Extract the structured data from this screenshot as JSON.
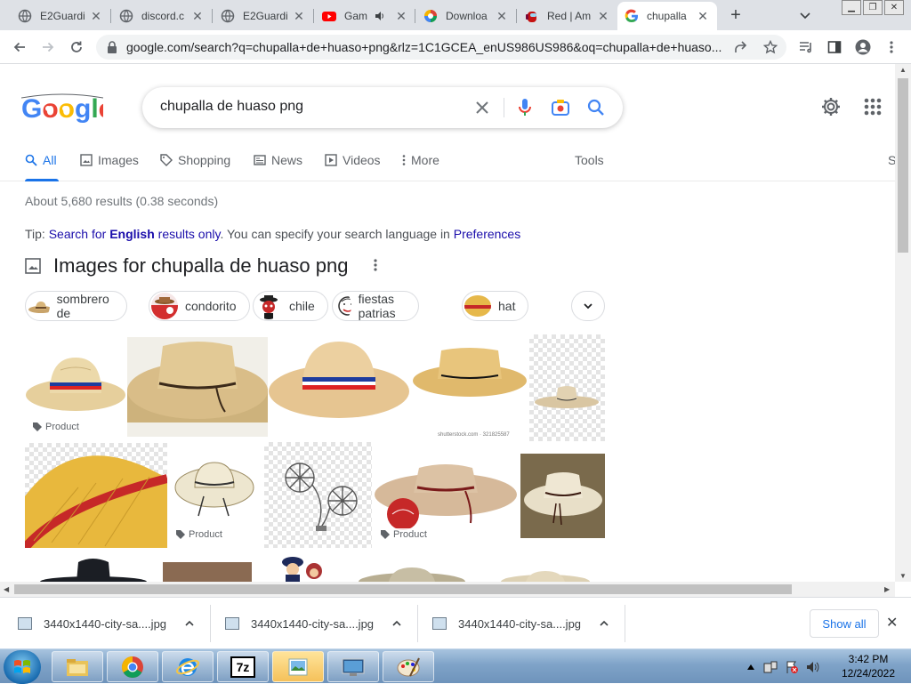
{
  "browser": {
    "tabs": [
      {
        "title": "E2Guardi",
        "icon": "globe-icon"
      },
      {
        "title": "discord.c",
        "icon": "globe-icon"
      },
      {
        "title": "E2Guardi",
        "icon": "globe-icon"
      },
      {
        "title": "Gam",
        "icon": "youtube-icon",
        "audio": true
      },
      {
        "title": "Downloa",
        "icon": "color-wheel-icon"
      },
      {
        "title": "Red | Am",
        "icon": "among-us-icon"
      },
      {
        "title": "chupalla",
        "icon": "google-icon",
        "active": true
      }
    ],
    "url": "google.com/search?q=chupalla+de+huaso+png&rlz=1C1GCEA_enUS986US986&oq=chupalla+de+huaso..."
  },
  "search": {
    "query": "chupalla de huaso png",
    "logo_text": "Google"
  },
  "nav": {
    "all": "All",
    "images": "Images",
    "shopping": "Shopping",
    "news": "News",
    "videos": "Videos",
    "more": "More",
    "tools": "Tools",
    "cut": "S"
  },
  "results": {
    "stats": "About 5,680 results (0.38 seconds)",
    "tip": {
      "prefix": "Tip: ",
      "search_for": "Search for ",
      "english": "English",
      "results_only": " results only",
      "middle": ". You can specify your search language in ",
      "preferences": "Preferences"
    }
  },
  "images_section": {
    "title": "Images for chupalla de huaso png",
    "chips": [
      "sombrero de",
      "condorito",
      "chile",
      "fiestas patrias",
      "hat"
    ],
    "product_label": "Product",
    "watermark": "shutterstock.com · 321825587"
  },
  "downloads": {
    "items": [
      "3440x1440-city-sa....jpg",
      "3440x1440-city-sa....jpg",
      "3440x1440-city-sa....jpg"
    ],
    "show_all": "Show all"
  },
  "taskbar": {
    "time": "3:42 PM",
    "date": "12/24/2022",
    "sevenzip": "7z"
  },
  "colors": {
    "accent": "#1a73e8",
    "link": "#1a0dab",
    "tabstrip": "#dee1e6"
  }
}
